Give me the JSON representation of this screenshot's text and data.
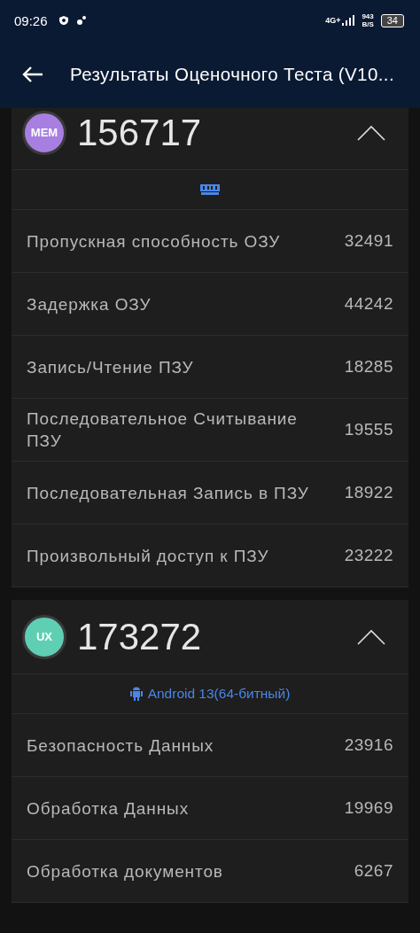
{
  "status_bar": {
    "time": "09:26",
    "network": "4G+",
    "speed_value": "943",
    "speed_unit": "B/S",
    "battery": "34"
  },
  "app_bar": {
    "title": "Результаты Оценочного Теста (V10..."
  },
  "cards": [
    {
      "badge": "MEM",
      "color": "#a77fe0",
      "score": "156717",
      "expanded": true,
      "kind": "memory",
      "rows": [
        {
          "label": "Пропускная способность ОЗУ",
          "value": "32491"
        },
        {
          "label": "Задержка ОЗУ",
          "value": "44242"
        },
        {
          "label": "Запись/Чтение ПЗУ",
          "value": "18285"
        },
        {
          "label": "Последовательное Считывание ПЗУ",
          "value": "19555"
        },
        {
          "label": "Последовательная Запись в ПЗУ",
          "value": "18922"
        },
        {
          "label": "Произвольный доступ к ПЗУ",
          "value": "23222"
        }
      ]
    },
    {
      "badge": "UX",
      "color": "#5fcfb3",
      "score": "173272",
      "expanded": true,
      "kind": "android",
      "info": "Android 13(64-битный)",
      "rows": [
        {
          "label": "Безопасность Данных",
          "value": "23916"
        },
        {
          "label": "Обработка Данных",
          "value": "19969"
        },
        {
          "label": "Обработка документов",
          "value": "6267"
        }
      ]
    }
  ]
}
